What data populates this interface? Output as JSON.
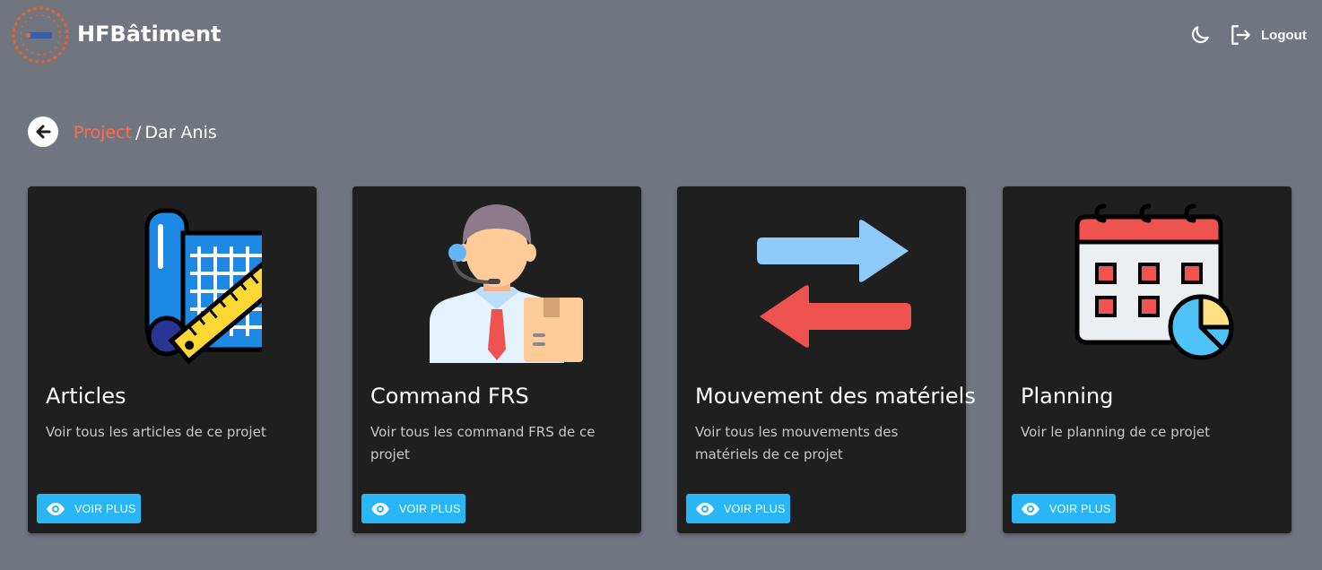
{
  "header": {
    "brand": "HFBâtiment",
    "logout_label": "Logout",
    "icons": {
      "theme": "moon-icon",
      "logout": "logout-icon"
    }
  },
  "breadcrumb": {
    "parent": "Project",
    "separator": "/",
    "current": "Dar Anis"
  },
  "colors": {
    "background": "#71757f",
    "card": "#1f1f1f",
    "accent": "#29b6f6",
    "link": "#ff6b4a"
  },
  "cards": [
    {
      "title": "Articles",
      "description": "Voir tous les articles de ce projet",
      "button": "VOIR PLUS",
      "icon": "blueprint-ruler-icon"
    },
    {
      "title": "Command FRS",
      "description": "Voir tous les command FRS de ce projet",
      "button": "VOIR PLUS",
      "icon": "delivery-agent-icon"
    },
    {
      "title": "Mouvement des matériels",
      "description": "Voir tous les mouvements des matériels de ce projet",
      "button": "VOIR PLUS",
      "icon": "transfer-arrows-icon"
    },
    {
      "title": "Planning",
      "description": "Voir le planning de ce projet",
      "button": "VOIR PLUS",
      "icon": "calendar-chart-icon"
    }
  ]
}
